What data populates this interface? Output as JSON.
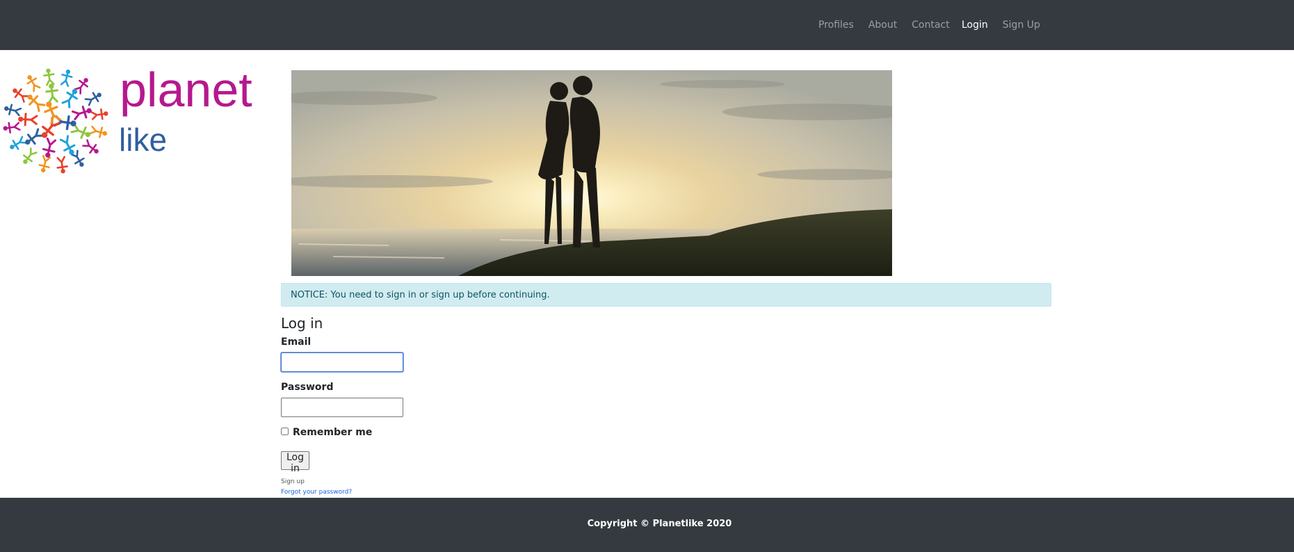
{
  "navbar": {
    "links": [
      {
        "label": "Profiles"
      },
      {
        "label": "About"
      },
      {
        "label": "Contact"
      }
    ],
    "auth_links": [
      {
        "label": "Login"
      },
      {
        "label": "Sign Up"
      }
    ]
  },
  "logo": {
    "word1": "planet",
    "word2": "like",
    "colors": [
      "#b5198e",
      "#2f5fa0",
      "#e8412c",
      "#f29420",
      "#8dc63f",
      "#1fa2d8"
    ]
  },
  "banner": {
    "icon": "sunset-couple-photo"
  },
  "notice": {
    "text": "NOTICE: You need to sign in or sign up before continuing."
  },
  "login_form": {
    "title": "Log in",
    "email_label": "Email",
    "email_value": "",
    "password_label": "Password",
    "password_value": "",
    "remember_label": "Remember me",
    "remember_checked": false,
    "submit_label": "Log in",
    "signup_link": "Sign up",
    "forgot_link": "Forgot your password?"
  },
  "footer": {
    "text": "Copyright © Planetlike 2020"
  },
  "colors": {
    "navbar_bg": "#343a40",
    "notice_bg": "#d1ecf1",
    "notice_text": "#0c5460",
    "link": "#1a62d8"
  }
}
